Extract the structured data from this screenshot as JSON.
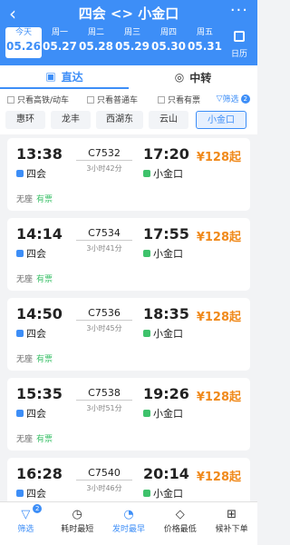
{
  "header": {
    "title": "四会 <> 小金口",
    "dates": [
      {
        "weekday": "今天",
        "date": "05.26",
        "selected": true
      },
      {
        "weekday": "周一",
        "date": "05.27",
        "selected": false
      },
      {
        "weekday": "周二",
        "date": "05.28",
        "selected": false
      },
      {
        "weekday": "周三",
        "date": "05.29",
        "selected": false
      },
      {
        "weekday": "周四",
        "date": "05.30",
        "selected": false
      },
      {
        "weekday": "周五",
        "date": "05.31",
        "selected": false
      }
    ],
    "calendar_label": "日历"
  },
  "tabs": {
    "direct": "直达",
    "transfer": "中转"
  },
  "filters": {
    "high_speed": "只看高铁/动车",
    "normal": "只看普通车",
    "available": "只看有票",
    "screen": "筛选",
    "screen_badge": "2"
  },
  "stations": [
    "惠环",
    "龙丰",
    "西湖东",
    "云山",
    "小金口"
  ],
  "trains": [
    {
      "dep_time": "13:38",
      "train_no": "C7532",
      "duration": "3小时42分",
      "arr_time": "17:20",
      "dep_station": "四会",
      "arr_station": "小金口",
      "price": "¥128起",
      "seat_none": "无座",
      "seat_avail": "有票"
    },
    {
      "dep_time": "14:14",
      "train_no": "C7534",
      "duration": "3小时41分",
      "arr_time": "17:55",
      "dep_station": "四会",
      "arr_station": "小金口",
      "price": "¥128起",
      "seat_none": "无座",
      "seat_avail": "有票"
    },
    {
      "dep_time": "14:50",
      "train_no": "C7536",
      "duration": "3小时45分",
      "arr_time": "18:35",
      "dep_station": "四会",
      "arr_station": "小金口",
      "price": "¥128起",
      "seat_none": "无座",
      "seat_avail": "有票"
    },
    {
      "dep_time": "15:35",
      "train_no": "C7538",
      "duration": "3小时51分",
      "arr_time": "19:26",
      "dep_station": "四会",
      "arr_station": "小金口",
      "price": "¥128起",
      "seat_none": "无座",
      "seat_avail": "有票"
    },
    {
      "dep_time": "16:28",
      "train_no": "C7540",
      "duration": "3小时46分",
      "arr_time": "20:14",
      "dep_station": "四会",
      "arr_station": "小金口",
      "price": "¥128起",
      "seat_none": "",
      "seat_avail": ""
    }
  ],
  "bottom_bar": [
    {
      "label": "筛选",
      "icon": "filter-icon",
      "badge": "2"
    },
    {
      "label": "耗时最短",
      "icon": "clock-icon"
    },
    {
      "label": "发时最早",
      "icon": "early-icon"
    },
    {
      "label": "价格最低",
      "icon": "price-tag-icon"
    },
    {
      "label": "候补下单",
      "icon": "cart-icon"
    }
  ]
}
